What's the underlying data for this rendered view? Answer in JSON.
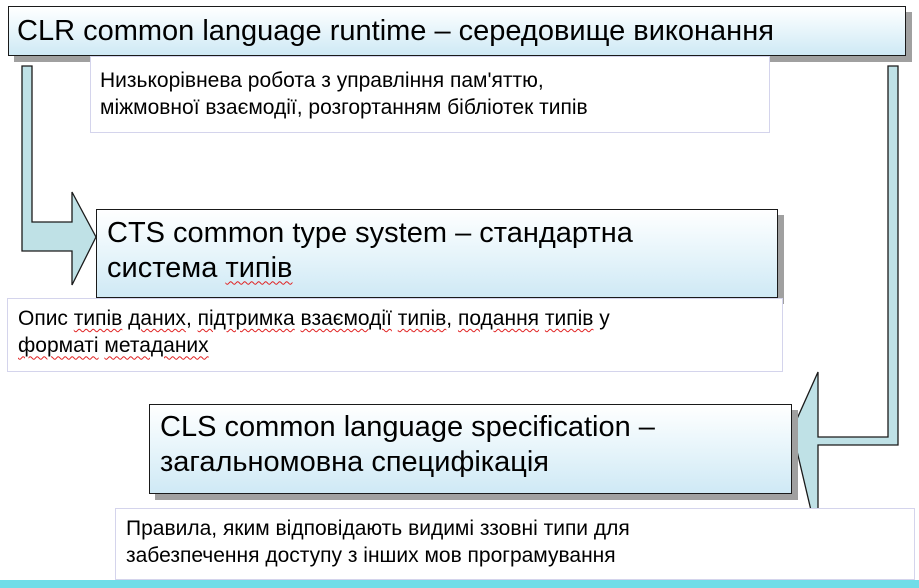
{
  "colors": {
    "arrow_fill": "#bfe1e6",
    "arrow_stroke": "#1a1a1a",
    "title_gradient_bottom": "#cfe9f5",
    "bottom_bar": "#6fdde8",
    "spellcheck_underline": "#e02020"
  },
  "clr": {
    "title": "CLR common language runtime – середовище виконання",
    "desc_line1": "Низькорівнева робота з управління пам'яттю,",
    "desc_line2": "міжмовної взаємодії, розгортанням бібліотек типів"
  },
  "cts": {
    "title_line1": "CTS common type system – стандартна",
    "title_line2_pre": "система ",
    "title_line2_err": "типів",
    "desc_line1_parts": [
      "Опис ",
      "типів",
      " ",
      "даних",
      ", ",
      "підтримка",
      " ",
      "взаємодії",
      " ",
      "типів",
      ", ",
      "подання",
      " ",
      "типів",
      " у"
    ],
    "desc_line2_parts": [
      "форматі",
      " ",
      "метаданих"
    ]
  },
  "cls": {
    "title_line1": "CLS common language specification –",
    "title_line2": "загальномовна специфікація",
    "desc_line1": "Правила, яким відповідають видимі ззовні типи для",
    "desc_line2": "забезпечення доступу з інших мов програмування"
  }
}
